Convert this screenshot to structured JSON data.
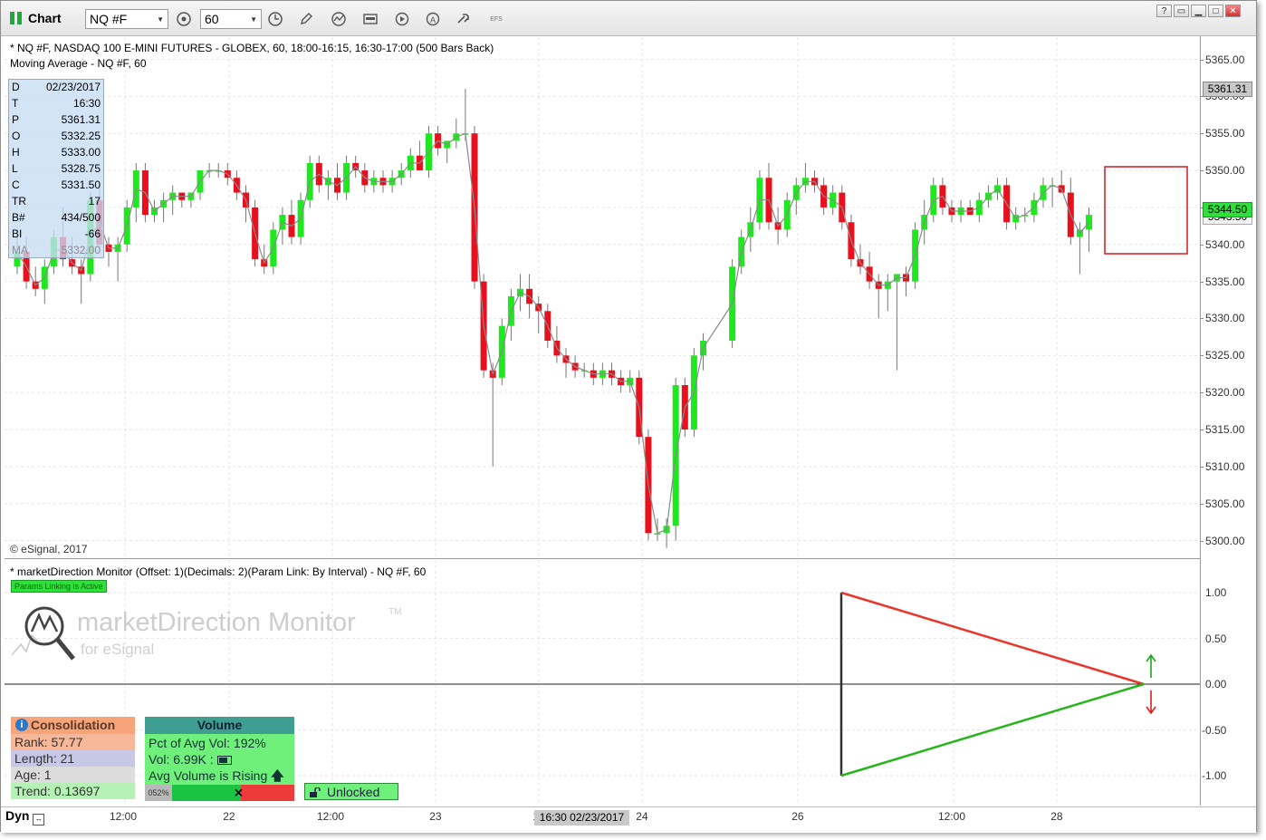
{
  "toolbar": {
    "title": "Chart",
    "symbol": "NQ #F",
    "interval": "60",
    "efs_label": "EFS",
    "help": "?",
    "icons": [
      "link-settings-icon",
      "pencil-icon",
      "study-icon",
      "calendar-icon",
      "play-icon",
      "alert-icon",
      "tools-icon",
      "efs-icon"
    ]
  },
  "chart": {
    "header_line1": "* NQ #F, NASDAQ 100 E-MINI FUTURES - GLOBEX, 60, 18:00-16:15, 16:30-17:00 (500 Bars Back)",
    "header_line2": "Moving Average - NQ #F, 60",
    "copyright": "© eSignal, 2017",
    "last_price": "5361.31",
    "current_price": "5344.50",
    "ma_price": "5343.50",
    "up_color": "#1ee81e",
    "down_color": "#e8101c",
    "ma_color": "#8a8a8a"
  },
  "data_window": [
    {
      "k": "D",
      "v": "02/23/2017"
    },
    {
      "k": "T",
      "v": "16:30"
    },
    {
      "k": "P",
      "v": "5361.31"
    },
    {
      "k": "O",
      "v": "5332.25"
    },
    {
      "k": "H",
      "v": "5333.00"
    },
    {
      "k": "L",
      "v": "5328.75"
    },
    {
      "k": "C",
      "v": "5331.50"
    },
    {
      "k": "TR",
      "v": "17"
    },
    {
      "k": "B#",
      "v": "434/500"
    },
    {
      "k": "BI",
      "v": "-66"
    },
    {
      "k": "MA",
      "v": "5332.00"
    }
  ],
  "indicator": {
    "title": "* marketDirection Monitor (Offset: 1)(Decimals: 2)(Param Link: By Interval) - NQ #F, 60",
    "params_badge": "Params Linking is Active",
    "logo_text": "marketDirection Monitor",
    "logo_tm": "TM",
    "logo_sub": "for eSignal",
    "y_ticks": [
      "1.00",
      "0.50",
      "0.00",
      "-0.50",
      "-1.00"
    ],
    "upper_color": "#e8362c",
    "lower_color": "#28b41c"
  },
  "consolidation": {
    "header": "Consolidation",
    "rows": [
      "Rank: 57.77",
      "Length: 21",
      "Age: 1",
      "Trend: 0.13697"
    ],
    "row_colors": [
      "#f7b89a",
      "#c8c8e6",
      "#dcdcdc",
      "#b6f2b6"
    ]
  },
  "volume": {
    "header": "Volume",
    "rows": [
      "Pct of Avg Vol: 192%",
      "Vol: 6.99K : ",
      "Avg Volume is Rising"
    ],
    "bar_label": "052%",
    "bar_fraction": 0.52
  },
  "lock": {
    "label": "Unlocked"
  },
  "time_axis": {
    "dyn": "Dyn",
    "labels": [
      "12:00",
      "22",
      "12:00",
      "23",
      "12",
      "24",
      "26",
      "12:00",
      "28"
    ],
    "cursor_label": "16:30 02/23/2017"
  },
  "chart_data": {
    "type": "candlestick",
    "y_ticks": [
      5365,
      5360,
      5355,
      5350,
      5345,
      5340,
      5335,
      5330,
      5325,
      5320,
      5315,
      5310,
      5305,
      5300
    ],
    "ylim": [
      5297.5,
      5368
    ],
    "bars": [
      [
        5337,
        5342,
        5336,
        5339
      ],
      [
        5339,
        5341,
        5334,
        5335
      ],
      [
        5335,
        5337,
        5333,
        5334
      ],
      [
        5334,
        5338,
        5332,
        5337
      ],
      [
        5337,
        5342,
        5336,
        5341
      ],
      [
        5341,
        5345,
        5337,
        5338
      ],
      [
        5338,
        5341,
        5336,
        5337
      ],
      [
        5337,
        5338,
        5332,
        5336
      ],
      [
        5336,
        5347,
        5335,
        5346
      ],
      [
        5346,
        5348,
        5339,
        5340
      ],
      [
        5340,
        5341,
        5337,
        5339
      ],
      [
        5339,
        5341,
        5335,
        5340
      ],
      [
        5340,
        5346,
        5339,
        5345
      ],
      [
        5345,
        5351,
        5343,
        5350
      ],
      [
        5350,
        5351,
        5343,
        5344
      ],
      [
        5344,
        5346,
        5343,
        5345
      ],
      [
        5345,
        5347,
        5343,
        5346
      ],
      [
        5346,
        5348,
        5344,
        5347
      ],
      [
        5347,
        5347,
        5345,
        5346
      ],
      [
        5346,
        5347,
        5345,
        5347
      ],
      [
        5347,
        5350,
        5346,
        5350
      ],
      [
        5350,
        5351,
        5349,
        5350
      ],
      [
        5350,
        5351,
        5349,
        5350
      ],
      [
        5350,
        5351,
        5348,
        5349
      ],
      [
        5349,
        5350,
        5346,
        5347
      ],
      [
        5347,
        5348,
        5343,
        5345
      ],
      [
        5345,
        5346,
        5337,
        5338
      ],
      [
        5338,
        5340,
        5336,
        5337
      ],
      [
        5337,
        5343,
        5336,
        5342
      ],
      [
        5342,
        5345,
        5340,
        5344
      ],
      [
        5344,
        5346,
        5340,
        5341
      ],
      [
        5341,
        5347,
        5340,
        5346
      ],
      [
        5346,
        5352,
        5345,
        5351
      ],
      [
        5351,
        5352,
        5347,
        5348
      ],
      [
        5348,
        5350,
        5346,
        5349
      ],
      [
        5349,
        5351,
        5346,
        5347
      ],
      [
        5347,
        5352,
        5346,
        5351
      ],
      [
        5351,
        5352,
        5349,
        5350
      ],
      [
        5350,
        5351,
        5347,
        5348
      ],
      [
        5348,
        5350,
        5347,
        5349
      ],
      [
        5349,
        5350,
        5347,
        5348
      ],
      [
        5348,
        5350,
        5347,
        5349
      ],
      [
        5349,
        5351,
        5348,
        5350
      ],
      [
        5350,
        5353,
        5349,
        5352
      ],
      [
        5352,
        5354,
        5350,
        5350
      ],
      [
        5350,
        5356,
        5349,
        5355
      ],
      [
        5355,
        5356,
        5352,
        5353
      ],
      [
        5353,
        5354,
        5351,
        5354
      ],
      [
        5354,
        5357,
        5353,
        5355
      ],
      [
        5355,
        5361,
        5354,
        5355
      ],
      [
        5355,
        5356,
        5334,
        5335
      ],
      [
        5335,
        5336,
        5322,
        5323
      ],
      [
        5323,
        5324,
        5310,
        5322
      ],
      [
        5322,
        5330,
        5321,
        5329
      ],
      [
        5329,
        5334,
        5327,
        5333
      ],
      [
        5333,
        5336,
        5331,
        5334
      ],
      [
        5334,
        5336,
        5330,
        5332
      ],
      [
        5332,
        5333,
        5328,
        5331
      ],
      [
        5331,
        5332,
        5326,
        5327
      ],
      [
        5327,
        5329,
        5324,
        5325
      ],
      [
        5325,
        5326,
        5322,
        5324
      ],
      [
        5324,
        5325,
        5322,
        5323
      ],
      [
        5323,
        5324,
        5322,
        5323
      ],
      [
        5323,
        5324,
        5321,
        5322
      ],
      [
        5322,
        5324,
        5321,
        5323
      ],
      [
        5323,
        5324,
        5321,
        5322
      ],
      [
        5322,
        5323,
        5320,
        5321
      ],
      [
        5321,
        5323,
        5320,
        5322
      ],
      [
        5322,
        5323,
        5313,
        5314
      ],
      [
        5314,
        5315,
        5300,
        5301
      ],
      [
        5301,
        5303,
        5300,
        5301
      ],
      [
        5301,
        5303,
        5299,
        5302
      ],
      [
        5302,
        5322,
        5300,
        5321
      ],
      [
        5321,
        5322,
        5314,
        5315
      ],
      [
        5315,
        5326,
        5314,
        5325
      ],
      [
        5325,
        5328,
        5323,
        5327
      ],
      [
        5327,
        5338,
        5326,
        5337
      ],
      [
        5337,
        5342,
        5336,
        5341
      ],
      [
        5341,
        5345,
        5339,
        5343
      ],
      [
        5343,
        5350,
        5342,
        5349
      ],
      [
        5349,
        5351,
        5342,
        5343
      ],
      [
        5343,
        5345,
        5340,
        5342
      ],
      [
        5342,
        5347,
        5341,
        5346
      ],
      [
        5346,
        5349,
        5344,
        5348
      ],
      [
        5348,
        5351,
        5347,
        5349
      ],
      [
        5349,
        5350,
        5347,
        5348
      ],
      [
        5348,
        5349,
        5344,
        5345
      ],
      [
        5345,
        5348,
        5344,
        5347
      ],
      [
        5347,
        5348,
        5342,
        5343
      ],
      [
        5343,
        5344,
        5337,
        5338
      ],
      [
        5338,
        5340,
        5336,
        5337
      ],
      [
        5337,
        5339,
        5334,
        5335
      ],
      [
        5335,
        5336,
        5330,
        5334
      ],
      [
        5334,
        5336,
        5331,
        5335
      ],
      [
        5335,
        5336,
        5323,
        5336
      ],
      [
        5336,
        5337,
        5333,
        5335
      ],
      [
        5335,
        5343,
        5334,
        5342
      ],
      [
        5342,
        5346,
        5340,
        5344
      ],
      [
        5344,
        5349,
        5343,
        5348
      ],
      [
        5348,
        5349,
        5344,
        5345
      ],
      [
        5345,
        5346,
        5343,
        5344
      ],
      [
        5344,
        5346,
        5343,
        5345
      ],
      [
        5345,
        5346,
        5344,
        5344
      ],
      [
        5344,
        5347,
        5343,
        5346
      ],
      [
        5346,
        5348,
        5345,
        5347
      ],
      [
        5347,
        5349,
        5346,
        5348
      ],
      [
        5348,
        5349,
        5342,
        5343
      ],
      [
        5343,
        5345,
        5342,
        5344
      ],
      [
        5344,
        5345,
        5343,
        5344
      ],
      [
        5344,
        5347,
        5343,
        5346
      ],
      [
        5346,
        5349,
        5345,
        5348
      ],
      [
        5348,
        5349,
        5345,
        5348
      ],
      [
        5348,
        5350,
        5347,
        5347
      ],
      [
        5347,
        5349,
        5340,
        5341
      ],
      [
        5341,
        5343,
        5336,
        5342
      ],
      [
        5342,
        5345,
        5339,
        5344
      ]
    ]
  }
}
